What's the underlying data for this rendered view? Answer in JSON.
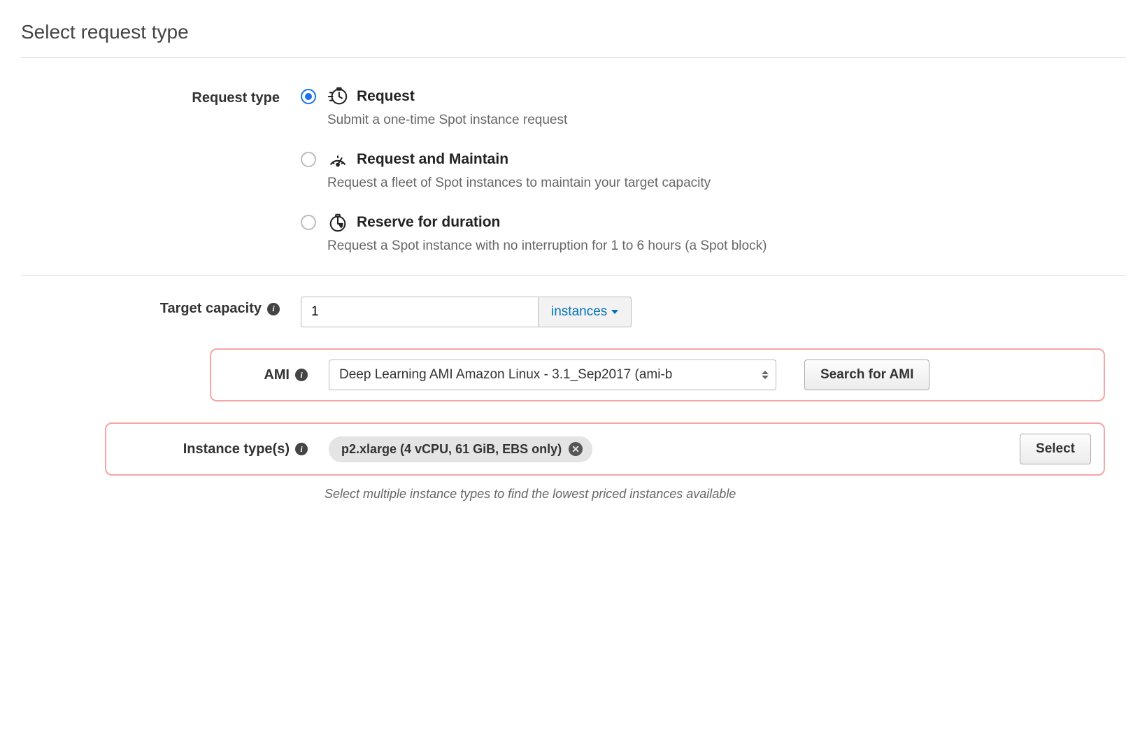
{
  "section_title": "Select request type",
  "labels": {
    "request_type": "Request type",
    "target_capacity": "Target capacity",
    "ami": "AMI",
    "instance_types": "Instance type(s)"
  },
  "request_type_options": [
    {
      "title": "Request",
      "desc": "Submit a one-time Spot instance request",
      "icon": "clock-fast-icon",
      "checked": true
    },
    {
      "title": "Request and Maintain",
      "desc": "Request a fleet of Spot instances to maintain your target capacity",
      "icon": "gauge-icon",
      "checked": false
    },
    {
      "title": "Reserve for duration",
      "desc": "Request a Spot instance with no interruption for 1 to 6 hours (a Spot block)",
      "icon": "clock-duration-icon",
      "checked": false
    }
  ],
  "target_capacity": {
    "value": "1",
    "unit_label": "instances"
  },
  "ami": {
    "selected": "Deep Learning AMI Amazon Linux - 3.1_Sep2017 (ami-b",
    "search_button": "Search for AMI"
  },
  "instance_types": {
    "tag": "p2.xlarge (4 vCPU, 61 GiB, EBS only)",
    "select_button": "Select",
    "help": "Select multiple instance types to find the lowest priced instances available"
  }
}
